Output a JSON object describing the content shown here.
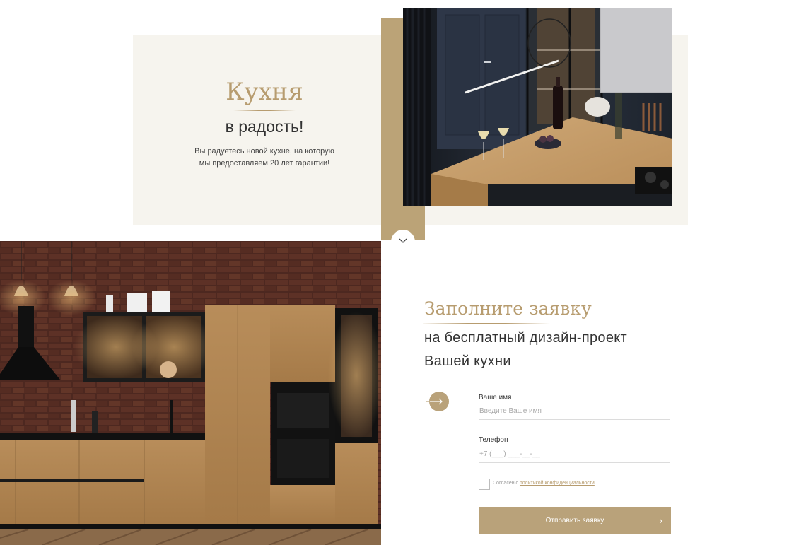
{
  "hero": {
    "title": "Кухня",
    "subtitle": "в радость!",
    "description_line1": "Вы радуетесь новой кухне, на которую",
    "description_line2": "мы предоставляем 20 лет гарантии!"
  },
  "scroll_down": {
    "icon": "chevron-down-icon"
  },
  "form": {
    "title": "Заполните заявку",
    "subtitle_line1": "на бесплатный дизайн-проект",
    "subtitle_line2": "Вашей кухни",
    "name": {
      "label": "Ваше имя",
      "placeholder": "Введите Ваше имя",
      "value": ""
    },
    "phone": {
      "label": "Телефон",
      "placeholder": "+7 (___) ___-__-__",
      "value": ""
    },
    "consent_text": "Согласен с ",
    "consent_link": "политикой конфиденциальности",
    "consent_checked": false,
    "submit_label": "Отправить заявку",
    "submit_icon": "chevron-right-icon",
    "arrow_icon": "arrow-right-icon"
  },
  "colors": {
    "accent": "#b79c6f",
    "button": "#b9a27a",
    "intro_bg": "#f6f4ee",
    "gold_bar": "#bba377"
  }
}
